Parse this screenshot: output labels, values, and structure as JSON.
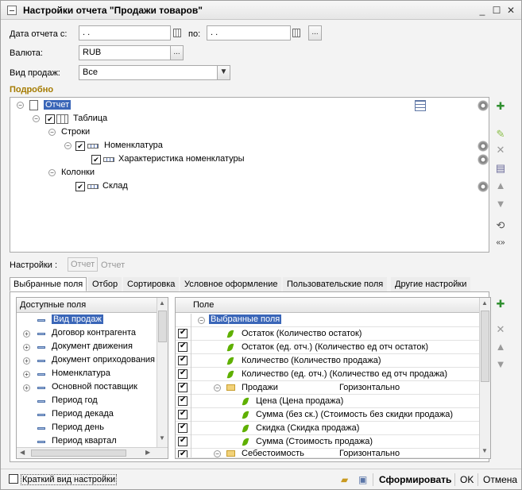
{
  "window": {
    "title": "Настройки отчета \"Продажи товаров\"",
    "minimize_glyph": "_",
    "maximize_glyph": "☐",
    "close_glyph": "✕"
  },
  "form": {
    "date_from_label": "Дата отчета с:",
    "date_from_value": " .  .",
    "date_to_label": "по:",
    "date_to_value": " .  .",
    "period_button": "...",
    "currency_label": "Валюта:",
    "currency_value": "RUB",
    "currency_button": "...",
    "sales_type_label": "Вид продаж:",
    "sales_type_value": "Все",
    "dropdown_glyph": "▼"
  },
  "details": {
    "section_title": "Подробно",
    "tree": [
      {
        "label": "Отчет",
        "selected": true
      },
      {
        "label": "Таблица"
      },
      {
        "label": "Строки"
      },
      {
        "label": "Номенклатура"
      },
      {
        "label": "Характеристика номенклатуры"
      },
      {
        "label": "Колонки"
      },
      {
        "label": "Склад"
      }
    ]
  },
  "settings": {
    "label": "Настройки :",
    "option_selected": "Отчет",
    "option_other": "Отчет"
  },
  "tabs": [
    {
      "label": "Выбранные поля",
      "active": true
    },
    {
      "label": "Отбор"
    },
    {
      "label": "Сортировка"
    },
    {
      "label": "Условное оформление"
    },
    {
      "label": "Пользовательские поля"
    },
    {
      "label": "Другие настройки"
    }
  ],
  "available_fields": {
    "header": "Доступные поля",
    "items": [
      {
        "label": "Вид продаж",
        "expandable": false,
        "selected": true
      },
      {
        "label": "Договор контрагента",
        "expandable": true
      },
      {
        "label": "Документ движения",
        "expandable": true
      },
      {
        "label": "Документ оприходования",
        "expandable": true
      },
      {
        "label": "Номенклатура",
        "expandable": true
      },
      {
        "label": "Основной поставщик",
        "expandable": true
      },
      {
        "label": "Период год",
        "expandable": false
      },
      {
        "label": "Период декада",
        "expandable": false
      },
      {
        "label": "Период день",
        "expandable": false
      },
      {
        "label": "Период квартал",
        "expandable": false
      }
    ]
  },
  "selected_fields": {
    "header": "Поле",
    "root": "Выбранные поля",
    "rows": [
      {
        "label": "Остаток (Количество остаток)",
        "kind": "leaf",
        "level": 1
      },
      {
        "label": "Остаток (ед. отч.) (Количество ед отч остаток)",
        "kind": "leaf",
        "level": 1
      },
      {
        "label": "Количество (Количество продажа)",
        "kind": "leaf",
        "level": 1
      },
      {
        "label": "Количество (ед. отч.) (Количество ед отч продажа)",
        "kind": "leaf",
        "level": 1
      },
      {
        "label": "Продажи",
        "kind": "folder",
        "level": 1,
        "extra": "Горизонтально"
      },
      {
        "label": "Цена (Цена продажа)",
        "kind": "leaf",
        "level": 2
      },
      {
        "label": "Сумма (без ск.) (Стоимость без скидки продажа)",
        "kind": "leaf",
        "level": 2
      },
      {
        "label": "Скидка (Скидка продажа)",
        "kind": "leaf",
        "level": 2
      },
      {
        "label": "Сумма (Стоимость продажа)",
        "kind": "leaf",
        "level": 2
      },
      {
        "label": "Себестоимость",
        "kind": "folder",
        "level": 1,
        "extra": "Горизонтально"
      }
    ]
  },
  "footer": {
    "short_view_label": "Краткий вид настройки",
    "generate_label": "Сформировать",
    "ok_label": "OK",
    "cancel_label": "Отмена"
  },
  "colors": {
    "selection": "#3a66b8",
    "section_title": "#a57b00",
    "leaf_green": "#5fb000"
  }
}
